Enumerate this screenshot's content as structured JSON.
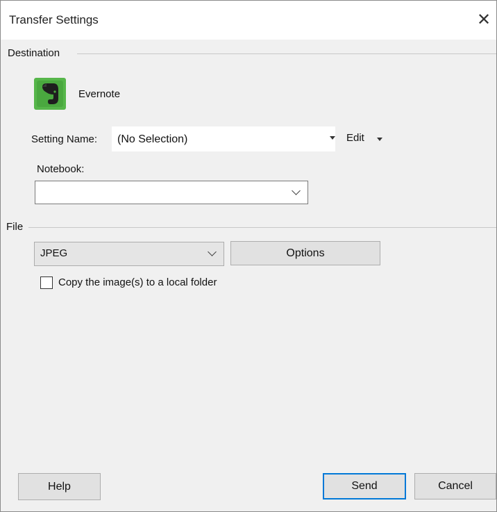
{
  "window": {
    "title": "Transfer Settings",
    "close_icon": "close-icon"
  },
  "destination": {
    "group_label": "Destination",
    "app_icon": "evernote-elephant-icon",
    "app_name": "Evernote",
    "setting_name_label": "Setting Name:",
    "setting_name_value": "(No Selection)",
    "edit_label": "Edit",
    "notebook_label": "Notebook:",
    "notebook_value": ""
  },
  "file": {
    "group_label": "File",
    "format_value": "JPEG",
    "options_label": "Options",
    "copy_checkbox_label": "Copy the image(s) to a local folder",
    "copy_checked": false
  },
  "footer": {
    "help_label": "Help",
    "send_label": "Send",
    "cancel_label": "Cancel"
  },
  "colors": {
    "evernote_green": "#56b64a",
    "default_button_border": "#0078d7"
  }
}
